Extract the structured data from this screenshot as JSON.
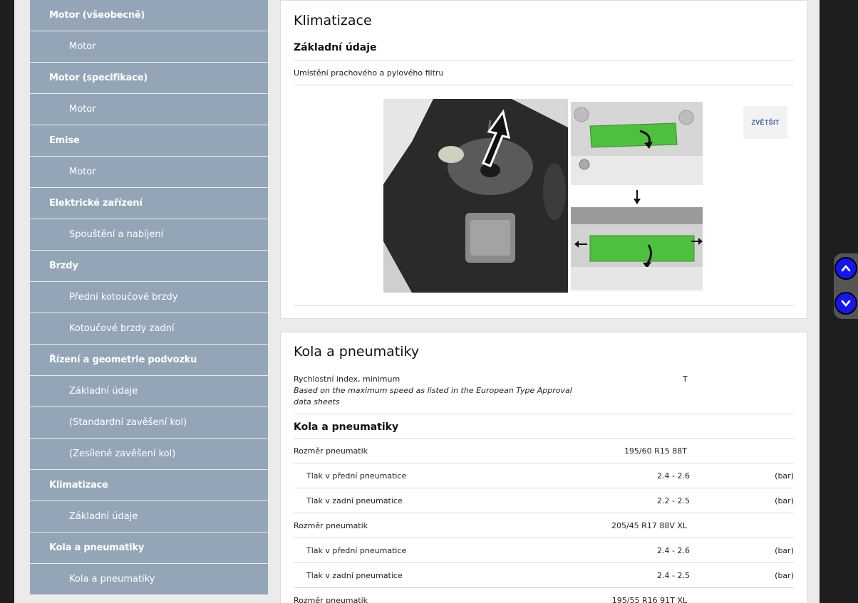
{
  "sidebar": {
    "items": [
      {
        "label": "Motor (všeobecně)",
        "kind": "heading"
      },
      {
        "label": "Motor",
        "kind": "sub"
      },
      {
        "label": "Motor (specifikace)",
        "kind": "heading"
      },
      {
        "label": "Motor",
        "kind": "sub"
      },
      {
        "label": "Emise",
        "kind": "heading"
      },
      {
        "label": "Motor",
        "kind": "sub"
      },
      {
        "label": "Elektrické zařízení",
        "kind": "heading"
      },
      {
        "label": "Spouštění a nabíjení",
        "kind": "sub"
      },
      {
        "label": "Brzdy",
        "kind": "heading"
      },
      {
        "label": "Přední kotoučové brzdy",
        "kind": "sub"
      },
      {
        "label": "Kotoučové brzdy zadní",
        "kind": "sub"
      },
      {
        "label": "Řízení a geometrie podvozku",
        "kind": "heading"
      },
      {
        "label": "Základní údaje",
        "kind": "sub"
      },
      {
        "label": "(Standardní zavěšení kol)",
        "kind": "sub"
      },
      {
        "label": "(Zesílené zavěšení kol)",
        "kind": "sub"
      },
      {
        "label": "Klimatizace",
        "kind": "heading"
      },
      {
        "label": "Základní údaje",
        "kind": "sub"
      },
      {
        "label": "Kola a pneumatiky",
        "kind": "heading"
      },
      {
        "label": "Kola a pneumatiky",
        "kind": "sub"
      }
    ]
  },
  "climate": {
    "title": "Klimatizace",
    "subtitle": "Základní údaje",
    "filter_label": "Umístění prachového a pylového filtru",
    "zoom_label": "ZVĚTŠIT"
  },
  "wheels": {
    "title": "Kola a pneumatiky",
    "speed_label": "Rychlostní index, minimum",
    "speed_note_1": "Based on the maximum speed as listed in the European Type Approval",
    "speed_note_2": "data sheets",
    "speed_value": "T",
    "subtitle": "Kola a pneumatiky",
    "rows": [
      {
        "label": "Rozměr pneumatik",
        "value": "195/60 R15 88T",
        "unit": "",
        "indent": false
      },
      {
        "label": "Tlak v přední pneumatice",
        "value": "2.4 - 2.6",
        "unit": "(bar)",
        "indent": true
      },
      {
        "label": "Tlak v zadní pneumatice",
        "value": "2.2 - 2.5",
        "unit": "(bar)",
        "indent": true
      },
      {
        "label": "Rozměr pneumatik",
        "value": "205/45 R17 88V XL",
        "unit": "",
        "indent": false
      },
      {
        "label": "Tlak v přední pneumatice",
        "value": "2.4 - 2.6",
        "unit": "(bar)",
        "indent": true
      },
      {
        "label": "Tlak v zadní pneumatice",
        "value": "2.4 - 2.5",
        "unit": "(bar)",
        "indent": true
      },
      {
        "label": "Rozměr pneumatik",
        "value": "195/55 R16 91T XL",
        "unit": "",
        "indent": false
      }
    ]
  },
  "colors": {
    "sidebar_bg": "#94a5b8",
    "scroll_button": "#1515ee",
    "filter_green": "#4fbf3f"
  },
  "icons": {
    "scroll_up": "chevron-up-icon",
    "scroll_down": "chevron-down-icon"
  }
}
